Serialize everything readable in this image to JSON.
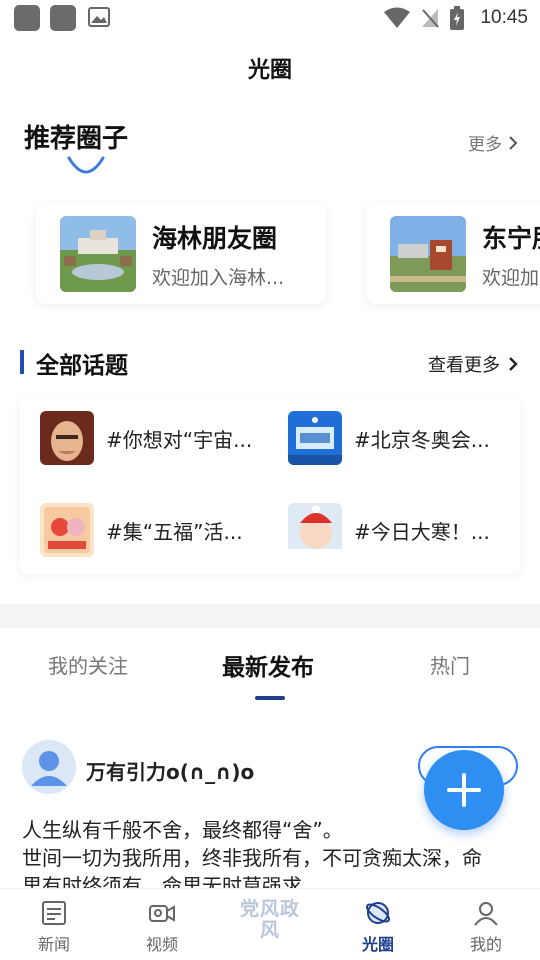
{
  "status_bar": {
    "time": "10:45"
  },
  "header": {
    "title": "光圈"
  },
  "recommended": {
    "title": "推荐圈子",
    "more_label": "更多",
    "circles": [
      {
        "name": "海林朋友圈",
        "desc": "欢迎加入海林..."
      },
      {
        "name": "东宁朋友圈",
        "desc": "欢迎加入东宁..."
      }
    ]
  },
  "topics": {
    "title": "全部话题",
    "more_label": "查看更多",
    "items": [
      {
        "label": "#你想对“宇宙..."
      },
      {
        "label": "#北京冬奥会..."
      },
      {
        "label": "#集“五福”活..."
      },
      {
        "label": "#今日大寒！..."
      }
    ]
  },
  "feed_tabs": [
    {
      "label": "我的关注"
    },
    {
      "label": "最新发布"
    },
    {
      "label": "热门"
    }
  ],
  "post": {
    "username": "万有引力o(∩_∩)o",
    "lines": [
      "人生纵有千般不舍，最终都得“舍”。",
      "世间一切为我所用，终非我所有，不可贪痴太深，命",
      "里有时终须有，命里无时莫强求。"
    ]
  },
  "bottom_nav": {
    "items": [
      {
        "label": "新闻"
      },
      {
        "label": "视频"
      },
      {
        "label": "党风政风"
      },
      {
        "label": "光圈"
      },
      {
        "label": "我的"
      }
    ]
  },
  "colors": {
    "accent": "#2d8ff2",
    "nav_active": "#1f3f8f"
  }
}
